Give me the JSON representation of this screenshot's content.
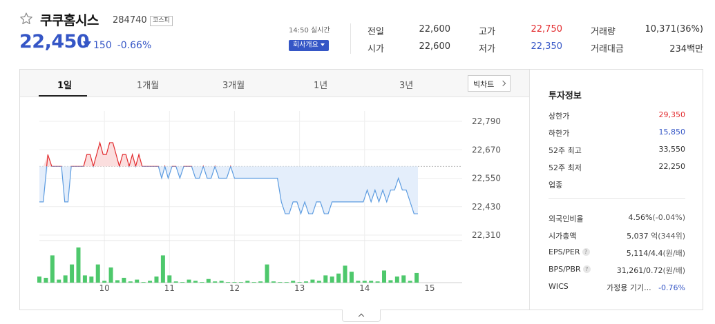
{
  "stock": {
    "name": "쿠쿠홈시스",
    "code": "284740",
    "market": "코스피",
    "price": "22,450",
    "change": "150",
    "change_pct": "-0.66%",
    "realtime_label": "14:50 실시간",
    "company_info_label": "회사개요"
  },
  "quote": {
    "prev_close_label": "전일",
    "prev_close": "22,600",
    "open_label": "시가",
    "open": "22,600",
    "high_label": "고가",
    "high": "22,750",
    "low_label": "저가",
    "low": "22,350",
    "volume_label": "거래량",
    "volume": "10,371(36%)",
    "amount_label": "거래대금",
    "amount": "234백만"
  },
  "tabs": [
    "1일",
    "1개월",
    "3개월",
    "1년",
    "3년"
  ],
  "big_chart_label": "빅차트",
  "colors": {
    "up": "#e2292c",
    "down": "#3556c6",
    "volume": "#4ec86c",
    "down_line": "#5b9be0"
  },
  "chart_data": {
    "type": "line",
    "y_ticks": [
      "22,790",
      "22,670",
      "22,550",
      "22,430",
      "22,310"
    ],
    "ylim": [
      22310,
      22790
    ],
    "x_ticks": [
      "10",
      "11",
      "12",
      "13",
      "14",
      "15"
    ],
    "xlim": [
      9,
      15.5
    ],
    "baseline": 22600,
    "series": [
      {
        "x": [
          9.0,
          9.06,
          9.13,
          9.19,
          9.24,
          9.29,
          9.34,
          9.39,
          9.44,
          9.49,
          9.54,
          9.59,
          9.64,
          9.68,
          9.73,
          9.78,
          9.83,
          9.88,
          9.93,
          9.98,
          10.03,
          10.08,
          10.13,
          10.18,
          10.23,
          10.28,
          10.33,
          10.38,
          10.43,
          10.48,
          10.53,
          10.58,
          10.63,
          10.68,
          10.73,
          10.78,
          10.83,
          10.88,
          10.93,
          10.98,
          11.04,
          11.1,
          11.16,
          11.22,
          11.28,
          11.34,
          11.4,
          11.46,
          11.52,
          11.58,
          11.64,
          11.7,
          11.76,
          11.82,
          11.88,
          11.94,
          12.0,
          12.06,
          12.12,
          12.18,
          12.24,
          12.3,
          12.36,
          12.42,
          12.48,
          12.54,
          12.6,
          12.66,
          12.72,
          12.78,
          12.84,
          12.9,
          12.96,
          13.02,
          13.08,
          13.14,
          13.2,
          13.26,
          13.32,
          13.38,
          13.44,
          13.5,
          13.56,
          13.62,
          13.68,
          13.74,
          13.8,
          13.86,
          13.92,
          13.98,
          14.04,
          14.1,
          14.16,
          14.22,
          14.28,
          14.34,
          14.4,
          14.46,
          14.52,
          14.58,
          14.64,
          14.7,
          14.76,
          14.82
        ],
        "y": [
          22450,
          22450,
          22650,
          22600,
          22600,
          22600,
          22600,
          22450,
          22450,
          22600,
          22600,
          22600,
          22600,
          22600,
          22650,
          22650,
          22600,
          22650,
          22700,
          22650,
          22650,
          22700,
          22700,
          22650,
          22600,
          22650,
          22650,
          22600,
          22650,
          22600,
          22650,
          22600,
          22600,
          22600,
          22600,
          22600,
          22600,
          22550,
          22600,
          22550,
          22600,
          22600,
          22550,
          22600,
          22600,
          22600,
          22550,
          22550,
          22600,
          22550,
          22550,
          22600,
          22550,
          22550,
          22550,
          22600,
          22550,
          22550,
          22550,
          22550,
          22550,
          22550,
          22550,
          22550,
          22550,
          22550,
          22550,
          22550,
          22450,
          22400,
          22400,
          22450,
          22450,
          22400,
          22450,
          22400,
          22400,
          22450,
          22450,
          22400,
          22400,
          22450,
          22450,
          22450,
          22450,
          22450,
          22450,
          22450,
          22450,
          22450,
          22500,
          22450,
          22500,
          22450,
          22500,
          22450,
          22500,
          22500,
          22550,
          22500,
          22500,
          22450,
          22400,
          22400
        ]
      }
    ],
    "volume": {
      "x": [
        9.0,
        9.1,
        9.2,
        9.3,
        9.4,
        9.5,
        9.6,
        9.7,
        9.8,
        9.9,
        10.0,
        10.1,
        10.2,
        10.3,
        10.4,
        10.5,
        10.6,
        10.7,
        10.8,
        10.9,
        11.0,
        11.1,
        11.2,
        11.3,
        11.4,
        11.5,
        11.6,
        11.7,
        11.8,
        11.9,
        12.0,
        12.1,
        12.2,
        12.3,
        12.4,
        12.5,
        12.6,
        12.7,
        12.8,
        12.9,
        13.0,
        13.1,
        13.2,
        13.3,
        13.4,
        13.5,
        13.6,
        13.7,
        13.8,
        13.9,
        14.0,
        14.1,
        14.2,
        14.3,
        14.4,
        14.5,
        14.6,
        14.7,
        14.8
      ],
      "values": [
        10,
        8,
        45,
        5,
        12,
        30,
        58,
        12,
        10,
        30,
        3,
        25,
        4,
        8,
        2,
        5,
        1,
        3,
        10,
        45,
        12,
        2,
        1,
        5,
        3,
        1,
        6,
        2,
        3,
        1,
        1,
        1,
        3,
        1,
        2,
        30,
        2,
        1,
        1,
        3,
        1,
        2,
        5,
        3,
        12,
        10,
        15,
        28,
        18,
        3,
        3,
        3,
        2,
        20,
        4,
        10,
        12,
        3,
        16
      ]
    }
  },
  "investment_info": {
    "title": "투자정보",
    "rows": [
      {
        "label": "상한가",
        "value": "29,350"
      },
      {
        "label": "하한가",
        "value": "15,850"
      },
      {
        "label": "52주 최고",
        "value": "33,550"
      },
      {
        "label": "52주 최저",
        "value": "22,250"
      },
      {
        "label": "업종",
        "value": ""
      }
    ],
    "rows2": [
      {
        "label": "외국인비율",
        "value": "4.56%",
        "sub": "(-0.04%)"
      },
      {
        "label": "시가총액",
        "value": "5,037",
        "sub": "억(344위)"
      },
      {
        "label": "EPS/PER",
        "value": "5,114/4.4",
        "sub": "(원/배)"
      },
      {
        "label": "BPS/PBR",
        "value": "31,261/0.72",
        "sub": "(원/배)"
      },
      {
        "label": "WICS",
        "value": "가정용 기기...",
        "sub": "-0.76%"
      }
    ]
  }
}
